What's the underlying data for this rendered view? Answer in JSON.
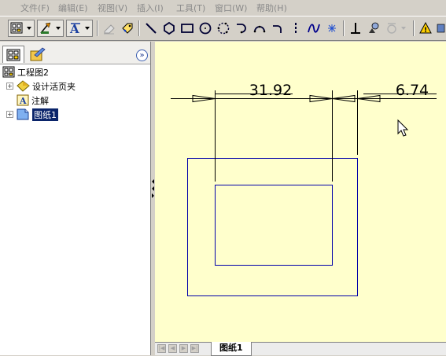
{
  "menu": [
    "文件(F)",
    "编辑(E)",
    "视图(V)",
    "插入(I)",
    "工具(T)",
    "窗口(W)",
    "帮助(H)"
  ],
  "toolbar": {
    "tools": [
      "drawing-view",
      "edit-pencil",
      "text-style",
      "eraser",
      "tag",
      "line",
      "polygon",
      "rectangle",
      "circle",
      "circle-3pt",
      "tangent-arc",
      "arc-3pt",
      "arc-end",
      "construction-line",
      "spline",
      "point",
      "perpendicular",
      "move",
      "add-target",
      "warning"
    ]
  },
  "panel": {
    "tabs": [
      "drawing-tree",
      "properties"
    ],
    "collapse_label": "»",
    "tree": {
      "root": "工程图2",
      "items": [
        {
          "label": "设计活页夹",
          "icon": "diamond-folder-icon",
          "expandable": true
        },
        {
          "label": "注解",
          "icon": "annotation-icon",
          "expandable": false
        },
        {
          "label": "图纸1",
          "icon": "sheet-icon",
          "expandable": true,
          "selected": true
        }
      ]
    }
  },
  "drawing": {
    "dimensions": [
      {
        "value": "31.92"
      },
      {
        "value": "6.74"
      }
    ],
    "line_color": "#0000aa",
    "dim_color": "#000000"
  },
  "sheet_tab": {
    "label": "图纸1"
  },
  "colors": {
    "canvas": "#ffffcc",
    "chrome": "#d4d0c8",
    "selection": "#0a246a"
  }
}
